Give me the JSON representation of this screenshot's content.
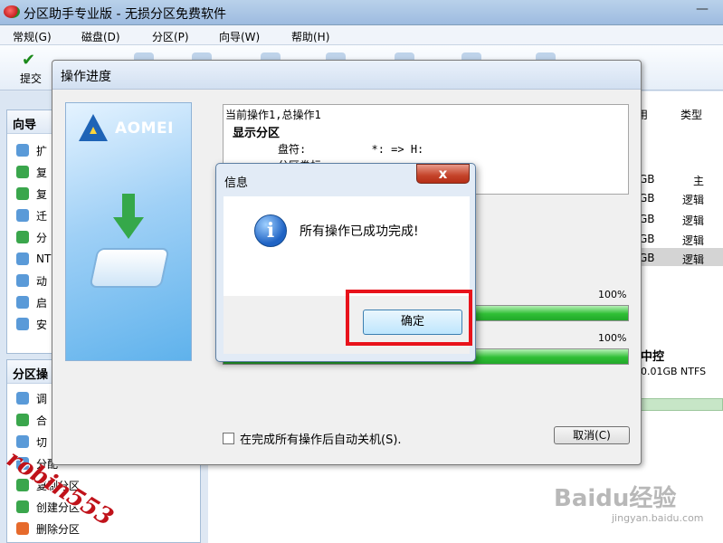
{
  "window": {
    "title": "分区助手专业版 - 无损分区免费软件"
  },
  "menu": [
    "常规(G)",
    "磁盘(D)",
    "分区(P)",
    "向导(W)",
    "帮助(H)"
  ],
  "toolbar": {
    "submit_label": "提交"
  },
  "left_panel": {
    "wizard_header": "向导",
    "wizard_items": [
      "扩",
      "复",
      "复",
      "迁",
      "分",
      "NT",
      "动",
      "启",
      "安"
    ],
    "partition_header": "分区操",
    "partition_items": [
      "调",
      "合",
      "切",
      "分配",
      "复制分区",
      "创建分区",
      "删除分区"
    ]
  },
  "list": {
    "col_capacity": "用",
    "col_type": "类型",
    "rows": [
      {
        "size": "GB",
        "type": "主"
      },
      {
        "size": "GB",
        "type": "逻辑"
      },
      {
        "size": "GB",
        "type": "逻辑"
      },
      {
        "size": "GB",
        "type": "逻辑"
      },
      {
        "size": "GB",
        "type": "逻辑"
      }
    ],
    "drive_name": "中控",
    "drive_size": "0.01GB NTFS"
  },
  "progress_dialog": {
    "title": "操作进度",
    "logo_text": "AOMEI",
    "log_line1": "当前操作1,总操作1",
    "log_line2": "显示分区",
    "log_line3": "盘符:          *: => H:",
    "log_line4": "分区卷标",
    "percent1": "100%",
    "percent2": "100%",
    "progress1": 1.0,
    "progress2": 1.0,
    "auto_shutdown_label": "在完成所有操作后自动关机(S).",
    "cancel_label": "取消(C)"
  },
  "info_dialog": {
    "title": "信息",
    "close_glyph": "x",
    "icon_glyph": "i",
    "message": "所有操作已成功完成!",
    "ok_label": "确定"
  },
  "watermarks": {
    "author": "robin553",
    "baidu": "Baidu经验",
    "url": "jingyan.baidu.com"
  },
  "colors": {
    "highlight": "#e8131b",
    "progress": "#2fbf35",
    "accent": "#1e63b6"
  }
}
